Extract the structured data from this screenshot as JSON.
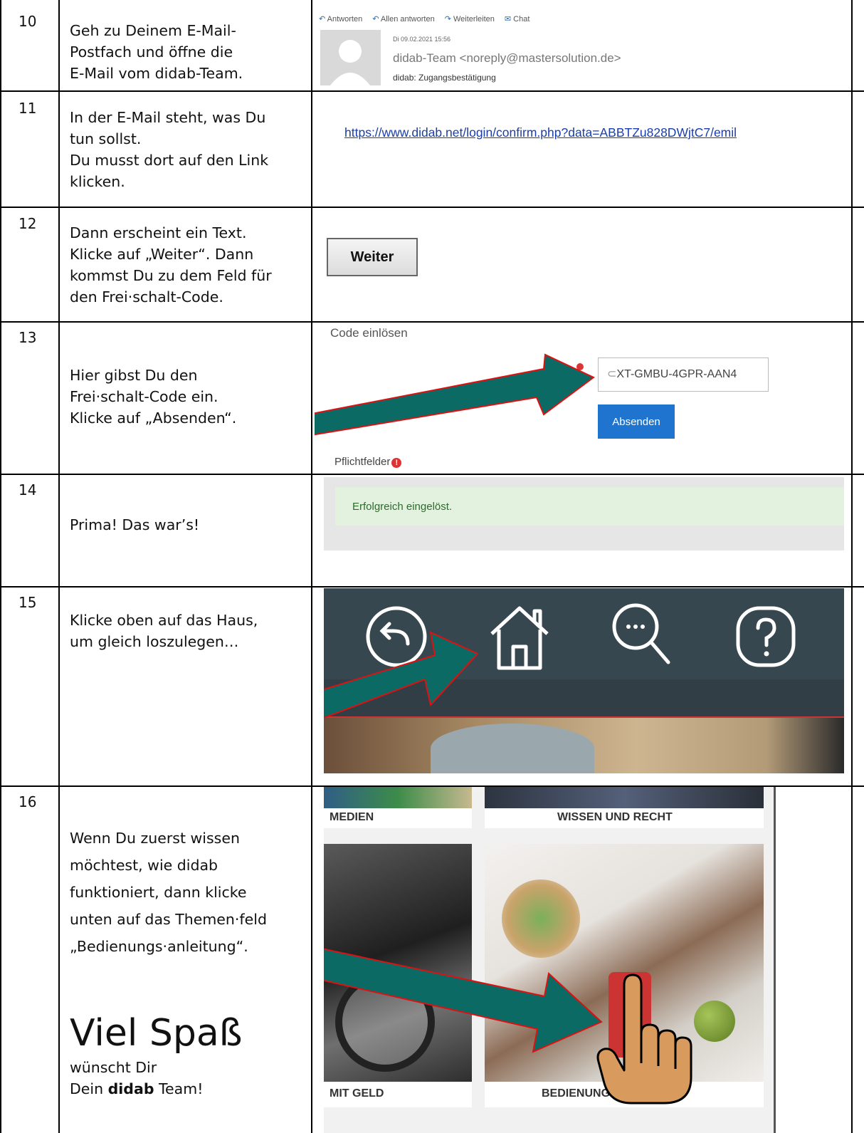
{
  "rows": [
    {
      "num": "10",
      "lines": [
        "Geh zu Deinem E-Mail-",
        "Postfach und öffne die",
        "E-Mail vom didab-Team."
      ]
    },
    {
      "num": "11",
      "lines": [
        "In der E-Mail steht, was Du",
        "tun sollst.",
        "Du musst dort auf den Link",
        "klicken."
      ]
    },
    {
      "num": "12",
      "lines": [
        "Dann erscheint ein Text.",
        "Klicke auf „Weiter“. Dann",
        "kommst Du zu dem Feld für",
        "den Frei·schalt-Code."
      ]
    },
    {
      "num": "13",
      "lines": [
        "Hier gibst Du den",
        "Frei·schalt-Code ein.",
        "Klicke auf „Absenden“."
      ]
    },
    {
      "num": "14",
      "lines": [
        "Prima! Das war’s!"
      ]
    },
    {
      "num": "15",
      "lines": [
        "Klicke oben auf das Haus,",
        "um gleich loszulegen…"
      ]
    },
    {
      "num": "16",
      "lines": [
        "Wenn Du zuerst wissen",
        "möchtest, wie didab",
        "funktioniert, dann klicke",
        "unten auf das Themen·feld",
        "„Bedienungs·anleitung“."
      ]
    }
  ],
  "closing": {
    "big": "Viel Spaß",
    "line1": "wünscht Dir",
    "line2_a": "Dein ",
    "line2_b": "didab",
    "line2_c": " Team!"
  },
  "email": {
    "toolbar": [
      "Antworten",
      "Allen antworten",
      "Weiterleiten",
      "Chat"
    ],
    "date": "Di 09.02.2021 15:56",
    "sender": "didab-Team <noreply@mastersolution.de>",
    "subject": "didab: Zugangsbestätigung"
  },
  "link": {
    "url": "https://www.didab.net/login/confirm.php?data=ABBTZu828DWjtC7/emil"
  },
  "weiter": {
    "label": "Weiter"
  },
  "code_form": {
    "title": "Code einlösen",
    "value": "XT-GMBU-4GPR-AAN4",
    "submit": "Absenden",
    "required": "Pflichtfelder"
  },
  "success": {
    "message": "Erfolgreich eingelöst."
  },
  "tiles": {
    "medien": "MEDIEN",
    "wissen": "WISSEN UND RECHT",
    "geld": "MIT GELD",
    "bedienung": "BEDIENUNGS·ANLEITUNG"
  },
  "colors": {
    "arrow": "#0b6b64",
    "arrow_border": "#d11",
    "nav_bg": "#37474f",
    "button_blue": "#1f74d0",
    "success_bg": "#e4f4e4",
    "hand": "#d99a5e"
  },
  "icons": {
    "back": "back-icon",
    "home": "home-icon",
    "search": "search-icon",
    "help": "help-icon"
  }
}
